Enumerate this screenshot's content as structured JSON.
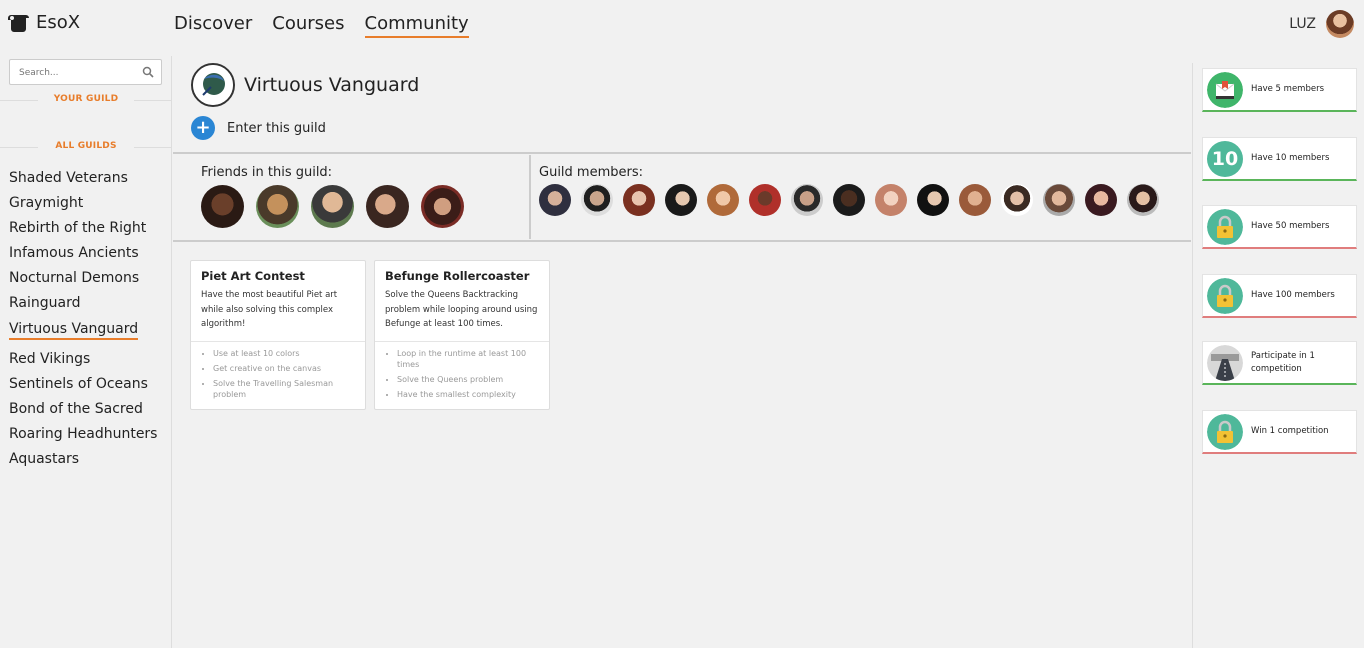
{
  "app": {
    "name": "EsoX"
  },
  "nav": {
    "items": [
      "Discover",
      "Courses",
      "Community"
    ],
    "active": "Community"
  },
  "user": {
    "name": "LUZ"
  },
  "sidebar": {
    "search_placeholder": "Search...",
    "your_guild_heading": "YOUR GUILD",
    "all_guilds_heading": "ALL GUILDS",
    "guilds": [
      "Shaded Veterans",
      "Graymight",
      "Rebirth of the Right",
      "Infamous Ancients",
      "Nocturnal Demons",
      "Rainguard",
      "Virtuous Vanguard",
      "Red Vikings",
      "Sentinels of Oceans",
      "Bond of the Sacred",
      "Roaring Headhunters",
      "Aquastars"
    ],
    "active_guild": "Virtuous Vanguard"
  },
  "guild": {
    "title": "Virtuous Vanguard",
    "enter_label": "Enter this guild",
    "friends_label": "Friends in this guild:",
    "members_label": "Guild members:"
  },
  "cards": [
    {
      "title": "Piet Art Contest",
      "description": "Have the most beautiful Piet art while also solving this complex algorithm!",
      "requirements": [
        "Use at least 10 colors",
        "Get creative on the canvas",
        "Solve the Travelling Salesman problem"
      ]
    },
    {
      "title": "Befunge Rollercoaster",
      "description": "Solve the Queens Backtracking problem while looping around using Befunge at least 100 times.",
      "requirements": [
        "Loop in the runtime at least 100 times",
        "Solve the Queens problem",
        "Have the smallest complexity"
      ]
    }
  ],
  "achievements": [
    {
      "label": "Have 5 members",
      "status": "complete",
      "icon": "mail-icon"
    },
    {
      "label": "Have 10 members",
      "status": "complete",
      "icon_text": "10"
    },
    {
      "label": "Have 50 members",
      "status": "locked",
      "icon": "lock-icon"
    },
    {
      "label": "Have 100 members",
      "status": "locked",
      "icon": "lock-icon"
    },
    {
      "label": "Participate in 1 competition",
      "status": "complete",
      "icon": "road-icon"
    },
    {
      "label": "Win 1 competition",
      "status": "locked",
      "icon": "lock-icon"
    }
  ],
  "colors": {
    "accent": "#e87d2b",
    "primary_button": "#2a86d4",
    "complete": "#5ab55a",
    "locked": "#e07d7d",
    "achievement_teal": "#4fb89a"
  }
}
